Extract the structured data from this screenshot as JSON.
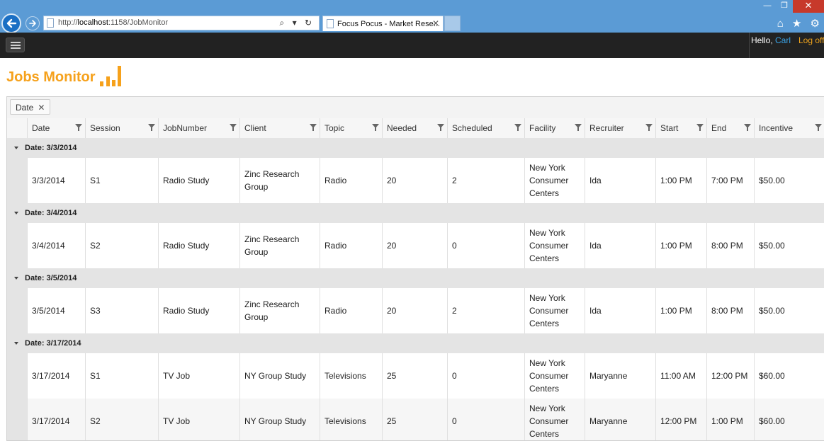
{
  "browser": {
    "url_prefix": "http://",
    "url_host": "localhost",
    "url_rest": ":1158/JobMonitor",
    "address_tools": "⌕ ▾ ↻",
    "tab_title": "Focus Pocus - Market Rese...",
    "tab_close": "✕",
    "window_controls": {
      "minimize": "—",
      "restore": "❐",
      "close": "✕"
    },
    "toolbar_icons": "⌂ ★ ⚙"
  },
  "navbar": {
    "greeting": "Hello, ",
    "user": "Carl",
    "logoff": "Log off"
  },
  "logo": {
    "text": "Jobs Monitor",
    "color": "#f6a11b"
  },
  "grid": {
    "group_chip": {
      "label": "Date",
      "close": "✕"
    },
    "columns": [
      "Date",
      "Session",
      "JobNumber",
      "Client",
      "Topic",
      "Needed",
      "Scheduled",
      "Facility",
      "Recruiter",
      "Start",
      "End",
      "Incentive"
    ],
    "groups": [
      {
        "label": "Date: 3/3/2014",
        "rows": [
          [
            "3/3/2014",
            "S1",
            "Radio Study",
            "Zinc Research Group",
            "Radio",
            "20",
            "2",
            "New York Consumer Centers",
            "Ida",
            "1:00 PM",
            "7:00 PM",
            "$50.00"
          ]
        ]
      },
      {
        "label": "Date: 3/4/2014",
        "rows": [
          [
            "3/4/2014",
            "S2",
            "Radio Study",
            "Zinc Research Group",
            "Radio",
            "20",
            "0",
            "New York Consumer Centers",
            "Ida",
            "1:00 PM",
            "8:00 PM",
            "$50.00"
          ]
        ]
      },
      {
        "label": "Date: 3/5/2014",
        "rows": [
          [
            "3/5/2014",
            "S3",
            "Radio Study",
            "Zinc Research Group",
            "Radio",
            "20",
            "2",
            "New York Consumer Centers",
            "Ida",
            "1:00 PM",
            "8:00 PM",
            "$50.00"
          ]
        ]
      },
      {
        "label": "Date: 3/17/2014",
        "rows": [
          [
            "3/17/2014",
            "S1",
            "TV Job",
            "NY Group Study",
            "Televisions",
            "25",
            "0",
            "New York Consumer Centers",
            "Maryanne",
            "11:00 AM",
            "12:00 PM",
            "$60.00"
          ],
          [
            "3/17/2014",
            "S2",
            "TV Job",
            "NY Group Study",
            "Televisions",
            "25",
            "0",
            "New York Consumer Centers",
            "Maryanne",
            "12:00 PM",
            "1:00 PM",
            "$60.00"
          ]
        ]
      }
    ]
  }
}
